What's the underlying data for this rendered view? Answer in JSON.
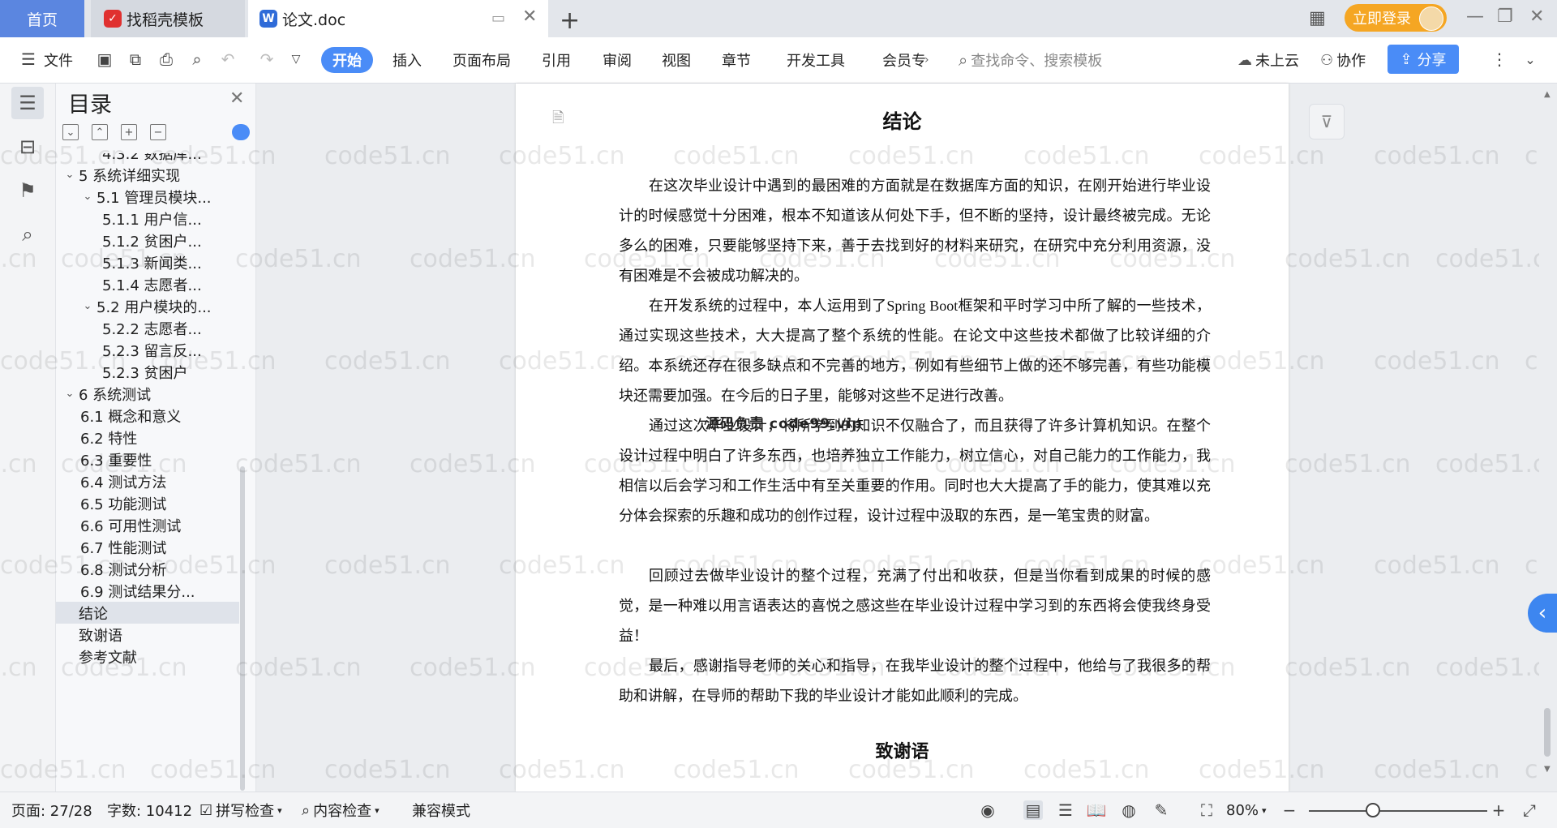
{
  "tabs": {
    "home": "首页",
    "template": "找稻壳模板",
    "document": "论文.doc",
    "new_tab": "+"
  },
  "login": {
    "label": "立即登录"
  },
  "toolbar": {
    "file": "文件",
    "menus": [
      "开始",
      "插入",
      "页面布局",
      "引用",
      "审阅",
      "视图",
      "章节",
      "开发工具",
      "会员专"
    ],
    "search_placeholder": "查找命令、搜索模板",
    "cloud": "未上云",
    "collab": "协作",
    "share": "分享"
  },
  "toc": {
    "title": "目录",
    "items": [
      {
        "label": "4.3.2 数据库...",
        "indent": 3,
        "caret": false
      },
      {
        "label": "5 系统详细实现",
        "indent": 1,
        "caret": true
      },
      {
        "label": "5.1  管理员模块...",
        "indent": 2,
        "caret": true
      },
      {
        "label": "5.1.1  用户信...",
        "indent": 3,
        "caret": false
      },
      {
        "label": "5.1.2  贫困户...",
        "indent": 3,
        "caret": false
      },
      {
        "label": "5.1.3  新闻类...",
        "indent": 3,
        "caret": false
      },
      {
        "label": "5.1.4  志愿者...",
        "indent": 3,
        "caret": false
      },
      {
        "label": "5.2  用户模块的...",
        "indent": 2,
        "caret": true
      },
      {
        "label": "5.2.2  志愿者...",
        "indent": 3,
        "caret": false
      },
      {
        "label": "5.2.3  留言反...",
        "indent": 3,
        "caret": false
      },
      {
        "label": "5.2.3  贫困户",
        "indent": 3,
        "caret": false
      },
      {
        "label": "6 系统测试",
        "indent": 1,
        "caret": true
      },
      {
        "label": "6.1 概念和意义",
        "indent": 2,
        "caret": false
      },
      {
        "label": "6.2 特性",
        "indent": 2,
        "caret": false
      },
      {
        "label": "6.3 重要性",
        "indent": 2,
        "caret": false
      },
      {
        "label": "6.4 测试方法",
        "indent": 2,
        "caret": false
      },
      {
        "label": "6.5  功能测试",
        "indent": 2,
        "caret": false
      },
      {
        "label": "6.6 可用性测试",
        "indent": 2,
        "caret": false
      },
      {
        "label": "6.7 性能测试",
        "indent": 2,
        "caret": false
      },
      {
        "label": "6.8 测试分析",
        "indent": 2,
        "caret": false
      },
      {
        "label": "6.9 测试结果分...",
        "indent": 2,
        "caret": false
      },
      {
        "label": "结论",
        "indent": 1,
        "caret": false,
        "selected": true
      },
      {
        "label": "致谢语",
        "indent": 1,
        "caret": false
      },
      {
        "label": "参考文献",
        "indent": 1,
        "caret": false
      }
    ]
  },
  "document": {
    "title": "结论",
    "paragraphs": [
      "在这次毕业设计中遇到的最困难的方面就是在数据库方面的知识，在刚开始进行毕业设计的时候感觉十分困难，根本不知道该从何处下手，但不断的坚持，设计最终被完成。无论多么的困难，只要能够坚持下来，善于去找到好的材料来研究，在研究中充分利用资源，没有困难是不会被成功解决的。",
      "在开发系统的过程中，本人运用到了Spring Boot框架和平时学习中所了解的一些技术，通过实现这些技术，大大提高了整个系统的性能。在论文中这些技术都做了比较详细的介绍。本系统还存在很多缺点和不完善的地方，例如有些细节上做的还不够完善，有些功能模块还需要加强。在今后的日子里，能够对这些不足进行改善。",
      "通过这次毕业设计，将所学到的知识不仅融合了，而且获得了许多计算机知识。在整个设计过程中明白了许多东西，也培养独立工作能力，树立信心，对自己能力的工作能力，我相信以后会学习和工作生活中有至关重要的作用。同时也大大提高了手的能力，使其难以充分体会探索的乐趣和成功的创作过程，设计过程中汲取的东西，是一笔宝贵的财富。",
      "回顾过去做毕业设计的整个过程，充满了付出和收获，但是当你看到成果的时候的感觉，是一种难以用言语表达的喜悦之感这些在毕业设计过程中学习到的东西将会使我终身受益！",
      "最后，感谢指导老师的关心和指导，在我毕业设计的整个过程中，他给与了我很多的帮助和讲解，在导师的帮助下我的毕业设计才能如此顺利的完成。"
    ],
    "next_heading": "致谢语",
    "overlay": "源码负责 code99.vip"
  },
  "watermark": "code51.cn",
  "status": {
    "page": "页面: 27/28",
    "words": "字数: 10412",
    "spell": "拼写检查",
    "content": "内容检查",
    "compat": "兼容模式",
    "zoom": "80%"
  }
}
